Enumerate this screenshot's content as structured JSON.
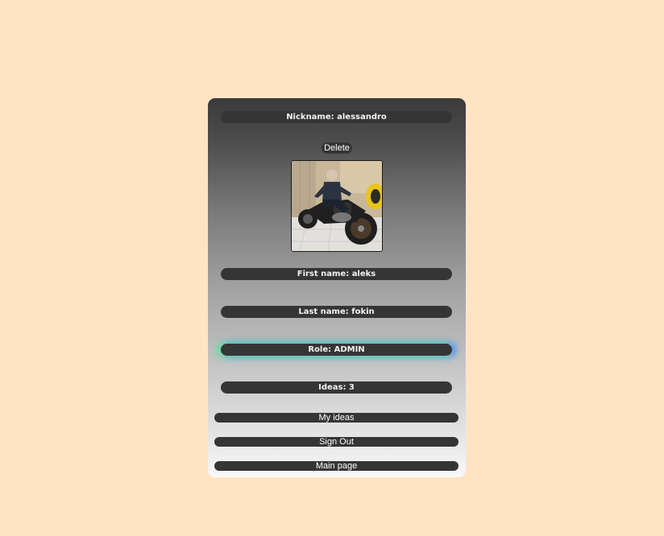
{
  "profile": {
    "nickname": "Nickname: alessandro",
    "delete_label": "Delete",
    "first_name": "First name: aleks",
    "last_name": "Last name: fokin",
    "role": "Role: ADMIN",
    "ideas": "Ideas: 3"
  },
  "actions": {
    "my_ideas": "My ideas",
    "sign_out": "Sign Out",
    "main_page": "Main page"
  },
  "colors": {
    "page_background": "#ffe4c4",
    "field_background": "#353535",
    "role_glow_left": "#5ae696",
    "role_glow_right": "#468cff"
  },
  "icons": {
    "avatar": "profile-photo-motorcycle"
  }
}
